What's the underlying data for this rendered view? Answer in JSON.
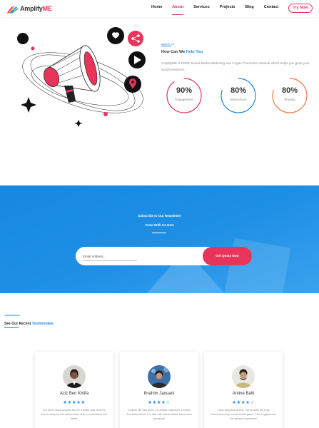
{
  "nav": {
    "logo_prefix": "Amplify",
    "logo_accent": "ME",
    "links": [
      "Home",
      "About",
      "Services",
      "Projects",
      "Blog",
      "Contact"
    ],
    "active_index": 1,
    "cta": "Try Now"
  },
  "about": {
    "tag": "ABOUT US",
    "title_prefix": "How Can We",
    "title_highlight": "Help You",
    "text": "AmplifyME is FREE Social Media Marketing and Crypto Promotion network which helps you grow your social presence.",
    "stats": [
      {
        "value": "90%",
        "label": "Engagement",
        "percent": 90,
        "color": "#e8335b"
      },
      {
        "value": "80%",
        "label": "Interactions",
        "percent": 80,
        "color": "#1e88e5"
      },
      {
        "value": "80%",
        "label": "Sharing",
        "percent": 80,
        "color": "#f2763a"
      }
    ]
  },
  "newsletter": {
    "title": "Subscribe to Our Newsletter",
    "subtitle": "Grow With Us Now",
    "placeholder": "Email Address...",
    "button": "Get Quote Now"
  },
  "testimonials": {
    "tag": "TESTIMONIALS",
    "title_prefix": "See Our Recent",
    "title_highlight": "Testimonials",
    "cards": [
      {
        "name": "Aziz Ben Khlifa",
        "stars": "★★★★★",
        "rating": 5,
        "text": "I've been using Amplify Me for a while now, and I'm blown away by the authenticity of the connections I've made."
      },
      {
        "name": "Ibrahim Jaouani",
        "stars": "★★★★☆",
        "rating": 4,
        "text": "Amplify Me has given my artistic exposure a boost. The interactions I've had with fellow artists have been amazing!"
      },
      {
        "name": "Amine Balti",
        "stars": "★★★★☆",
        "rating": 4,
        "text": "I was skeptical at first, but Amplify Me truly transformed my social media game. The engagement I've gained is genuine!"
      }
    ]
  },
  "colors": {
    "accent_pink": "#e8335b",
    "accent_blue": "#1e88e5",
    "accent_orange": "#f2763a"
  }
}
